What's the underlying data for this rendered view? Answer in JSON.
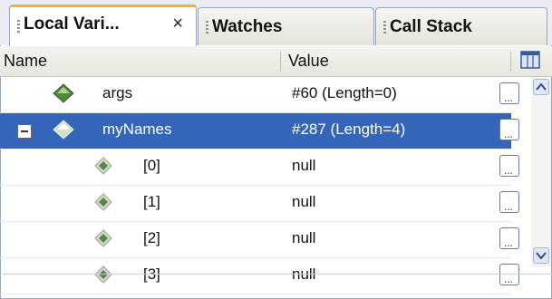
{
  "tabs": [
    {
      "label": "Local Vari...",
      "active": true,
      "closable": true
    },
    {
      "label": "Watches",
      "active": false,
      "closable": false
    },
    {
      "label": "Call Stack",
      "active": false,
      "closable": false
    }
  ],
  "close_glyph": "×",
  "columns": {
    "name": "Name",
    "value": "Value"
  },
  "rows": [
    {
      "name": "args",
      "value": "#60 (Length=0)",
      "icon": "field-diamond-icon",
      "selected": false
    },
    {
      "name": "myNames",
      "value": "#287 (Length=4)",
      "icon": "field-diamond-icon",
      "selected": true,
      "expanded": true
    },
    {
      "name": "[0]",
      "value": "null",
      "icon": "element-diamond-icon",
      "selected": false
    },
    {
      "name": "[1]",
      "value": "null",
      "icon": "element-diamond-icon",
      "selected": false
    },
    {
      "name": "[2]",
      "value": "null",
      "icon": "element-diamond-icon",
      "selected": false
    },
    {
      "name": "[3]",
      "value": "null",
      "icon": "element-diamond-icon",
      "selected": false
    }
  ],
  "ellipsis_glyph": "...",
  "colors": {
    "selection": "#3465b9",
    "active_tab_accent": "#f0b040"
  }
}
